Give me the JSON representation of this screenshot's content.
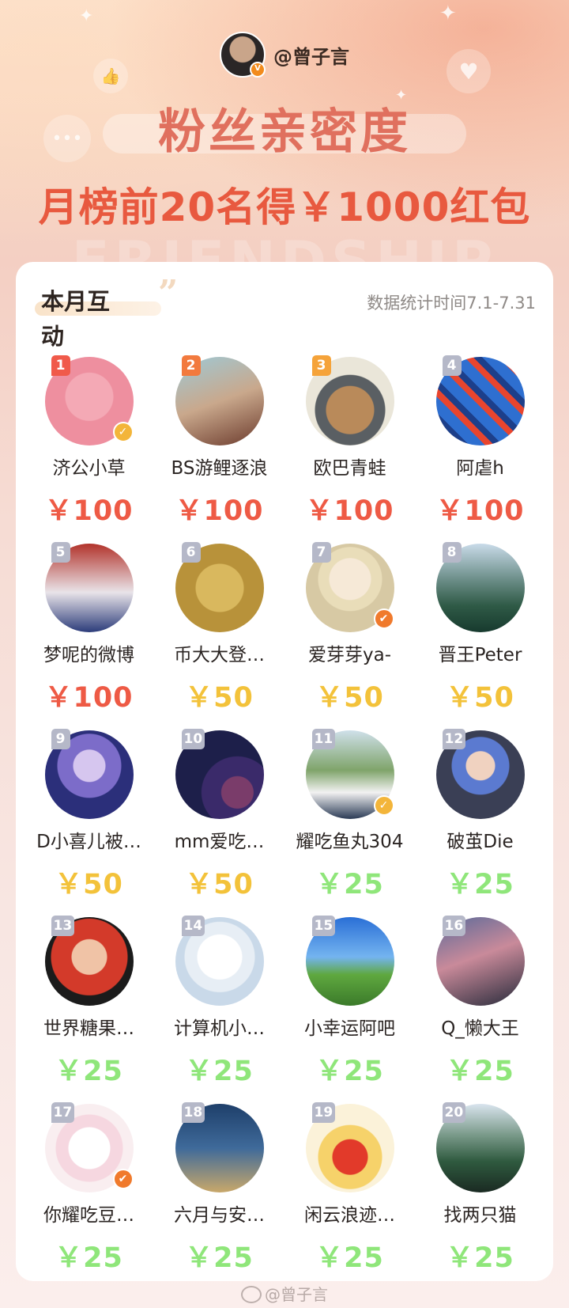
{
  "header": {
    "handle": "@曾子言",
    "title": "粉丝亲密度",
    "subtitle": "月榜前20名得￥1000红包",
    "ghost_text": "FRIENDSHIP"
  },
  "card": {
    "title": "本月互动",
    "quote_mark": "”",
    "stats_time": "数据统计时间7.1-7.31"
  },
  "colors": {
    "rank_top1": "#f05a4a",
    "rank_top2": "#f27a3e",
    "rank_top3": "#f5a33a",
    "rank_other": "#b5b8c8",
    "amount_100": "#ee5a45",
    "amount_50": "#f3c23a",
    "amount_25": "#8fe67a",
    "verified": "#f3b53a",
    "verified_orange": "#f07a2c"
  },
  "fans": [
    {
      "rank": "1",
      "name": "济公小草",
      "amount": "￥100",
      "tier": "100",
      "verified": "gold",
      "avatar_bg": "radial-gradient(circle at 50% 45%, #f4a9b5 0 30px, #ee8f9f 31px 56px)"
    },
    {
      "rank": "2",
      "name": "BS游鲤逐浪",
      "amount": "￥100",
      "tier": "100",
      "verified": "",
      "avatar_bg": "linear-gradient(160deg, #9ec9d6 0%, #c9a88c 50%, #6b3a2c 100%)"
    },
    {
      "rank": "3",
      "name": "欧巴青蛙",
      "amount": "￥100",
      "tier": "100",
      "verified": "",
      "avatar_bg": "radial-gradient(circle at 50% 60%, #b98a5a 0 30px, #5a5f63 31px 44px, #eae6d9 45px)"
    },
    {
      "rank": "4",
      "name": "阿虐h",
      "amount": "￥100",
      "tier": "100",
      "verified": "",
      "avatar_bg": "repeating-linear-gradient(45deg, #2e6fd0 0 14px, #e8452e 14px 22px, #1d3f8a 22px 30px)"
    },
    {
      "rank": "5",
      "name": "梦呢的微博",
      "amount": "￥100",
      "tier": "100",
      "verified": "",
      "avatar_bg": "linear-gradient(180deg, #b2332b 0%, #e9e4e9 55%, #2c3c7a 100%)"
    },
    {
      "rank": "6",
      "name": "币大大登…",
      "amount": "￥50",
      "tier": "50",
      "verified": "",
      "avatar_bg": "radial-gradient(circle at 50% 50%, #d9b85e 0 30px, #b8923a 31px)"
    },
    {
      "rank": "7",
      "name": "爱芽芽ya-",
      "amount": "￥50",
      "tier": "50",
      "verified": "orange",
      "avatar_bg": "radial-gradient(circle at 50% 40%, #f6e9d7 0 26px, #e9ddb9 27px 40px, #d7c9a4 41px)"
    },
    {
      "rank": "8",
      "name": "晋王Peter",
      "amount": "￥50",
      "tier": "50",
      "verified": "",
      "avatar_bg": "linear-gradient(180deg, #c9dbe9 0%, #6d8f8a 40%, #2f5a46 70%, #173a2e 100%)"
    },
    {
      "rank": "9",
      "name": "D小喜儿被…",
      "amount": "￥50",
      "tier": "50",
      "verified": "",
      "avatar_bg": "radial-gradient(circle at 50% 40%, #d6c6ef 0 20px, #7c6cc9 21px 40px, #2b2f7a 41px)"
    },
    {
      "rank": "10",
      "name": "mm爱吃…",
      "amount": "￥50",
      "tier": "50",
      "verified": "",
      "avatar_bg": "radial-gradient(circle at 70% 70%, #7a3c6a 0 20px, #3a2a6a 21px 45px, #1d1f4a 46px)"
    },
    {
      "rank": "11",
      "name": "耀吃鱼丸304",
      "amount": "￥25",
      "tier": "25",
      "verified": "gold",
      "avatar_bg": "linear-gradient(180deg, #cfe0ea 0%, #7fa46a 45%, #f2f2f2 70%, #2a3a55 100%)"
    },
    {
      "rank": "12",
      "name": "破茧Die",
      "amount": "￥25",
      "tier": "25",
      "verified": "",
      "avatar_bg": "radial-gradient(circle at 50% 40%, #f0d2c0 0 18px, #5b7ad0 19px 36px, #3a3f55 37px)"
    },
    {
      "rank": "13",
      "name": "世界糖果…",
      "amount": "￥25",
      "tier": "25",
      "verified": "",
      "avatar_bg": "radial-gradient(circle at 50% 45%, #f0c3a6 0 22px, #d33a2a 23px 48px, #1b1b1b 49px)"
    },
    {
      "rank": "14",
      "name": "计算机小…",
      "amount": "￥25",
      "tier": "25",
      "verified": "",
      "avatar_bg": "radial-gradient(circle at 50% 45%, #ffffff 0 28px, #e7eef5 29px 44px, #c9d9e9 45px)"
    },
    {
      "rank": "15",
      "name": "小幸运阿吧",
      "amount": "￥25",
      "tier": "25",
      "verified": "",
      "avatar_bg": "linear-gradient(180deg, #2a6fd6 0%, #74b4f0 45%, #5fa83f 65%, #3b7a2a 100%)"
    },
    {
      "rank": "16",
      "name": "Q_懒大王",
      "amount": "￥25",
      "tier": "25",
      "verified": "",
      "avatar_bg": "linear-gradient(160deg, #5a6a9a 0%, #c98a9a 45%, #262a3a 100%)"
    },
    {
      "rank": "17",
      "name": "你耀吃豆…",
      "amount": "￥25",
      "tier": "25",
      "verified": "orange",
      "avatar_bg": "radial-gradient(circle at 50% 50%, #ffffff 0 26px, #f6d7e0 27px 42px, #f9eef0 43px)"
    },
    {
      "rank": "18",
      "name": "六月与安…",
      "amount": "￥25",
      "tier": "25",
      "verified": "",
      "avatar_bg": "linear-gradient(180deg, #1e3f6a 0%, #3f6a9a 50%, #c9a86a 100%)"
    },
    {
      "rank": "19",
      "name": "闲云浪迹…",
      "amount": "￥25",
      "tier": "25",
      "verified": "",
      "avatar_bg": "radial-gradient(circle at 50% 60%, #e23a2a 0 22px, #f6d26a 23px 40px, #fbf2d9 41px)"
    },
    {
      "rank": "20",
      "name": "找两只猫",
      "amount": "￥25",
      "tier": "25",
      "verified": "",
      "avatar_bg": "linear-gradient(180deg, #d9e4ee 0%, #7a9a8a 35%, #2f5a3f 65%, #1a2a22 100%)"
    }
  ],
  "watermark": "@曾子言"
}
